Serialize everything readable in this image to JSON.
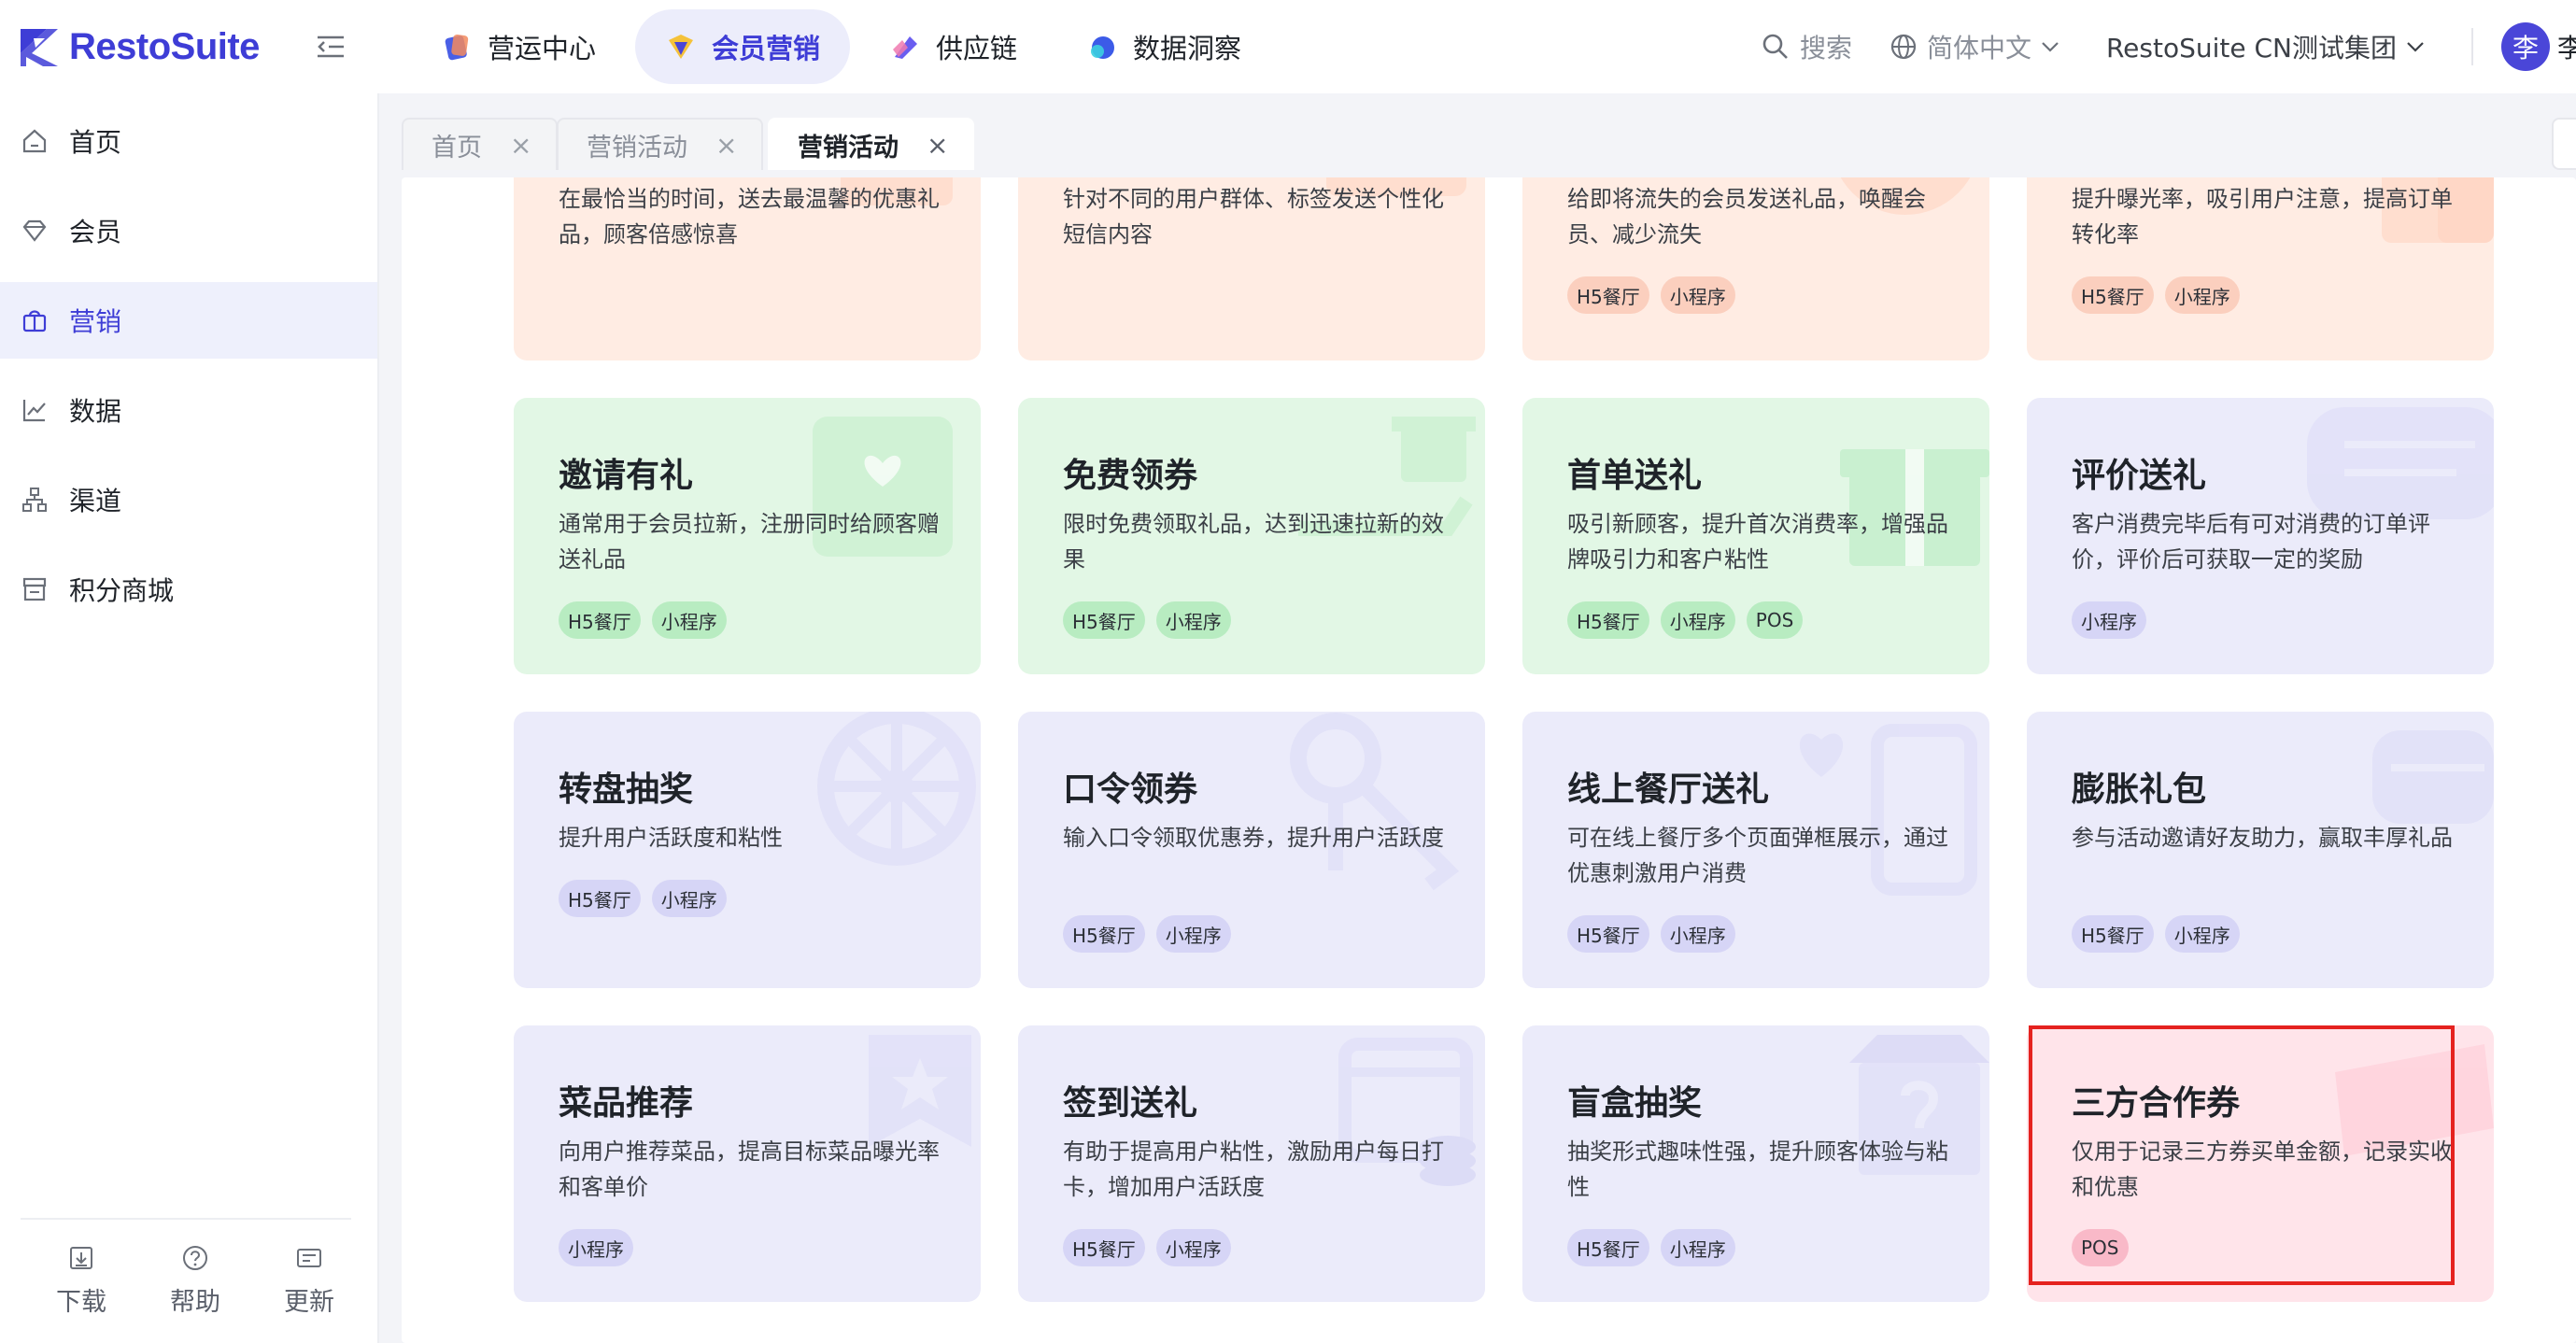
{
  "brand": {
    "name": "RestoSuite",
    "accent": "#3e3dd6"
  },
  "topnav": [
    {
      "label": "营运中心",
      "icon": "operations-icon",
      "active": false
    },
    {
      "label": "会员营销",
      "icon": "marketing-icon",
      "active": true
    },
    {
      "label": "供应链",
      "icon": "supply-chain-icon",
      "active": false
    },
    {
      "label": "数据洞察",
      "icon": "insights-icon",
      "active": false
    }
  ],
  "header": {
    "search_label": "搜索",
    "language": "简体中文",
    "org": "RestoSuite CN测试集团",
    "avatar_text": "李",
    "user_name": "李"
  },
  "sidebar": {
    "items": [
      {
        "label": "首页",
        "icon": "home-icon"
      },
      {
        "label": "会员",
        "icon": "diamond-icon"
      },
      {
        "label": "营销",
        "icon": "gift-bag-icon",
        "active": true
      },
      {
        "label": "数据",
        "icon": "chart-line-icon"
      },
      {
        "label": "渠道",
        "icon": "channel-icon"
      },
      {
        "label": "积分商城",
        "icon": "store-icon"
      }
    ],
    "footer": [
      {
        "label": "下载",
        "icon": "download-icon"
      },
      {
        "label": "帮助",
        "icon": "help-icon"
      },
      {
        "label": "更新",
        "icon": "update-icon"
      }
    ]
  },
  "tabs": [
    {
      "label": "首页",
      "active": false
    },
    {
      "label": "营销活动",
      "active": false
    },
    {
      "label": "营销活动",
      "active": true
    }
  ],
  "cards": [
    {
      "title": "",
      "desc": "在最恰当的时间，送去最温馨的优惠礼品，顾客倍感惊喜",
      "tags": [],
      "theme": "peach"
    },
    {
      "title": "",
      "desc": "针对不同的用户群体、标签发送个性化短信内容",
      "tags": [],
      "theme": "peach"
    },
    {
      "title": "",
      "desc": "给即将流失的会员发送礼品，唤醒会员、减少流失",
      "tags": [
        "H5餐厅",
        "小程序"
      ],
      "theme": "peach"
    },
    {
      "title": "",
      "desc": "提升曝光率，吸引用户注意，提高订单转化率",
      "tags": [
        "H5餐厅",
        "小程序"
      ],
      "theme": "peach"
    },
    {
      "title": "邀请有礼",
      "desc": "通常用于会员拉新，注册同时给顾客赠送礼品",
      "tags": [
        "H5餐厅",
        "小程序"
      ],
      "theme": "green"
    },
    {
      "title": "免费领券",
      "desc": "限时免费领取礼品，达到迅速拉新的效果",
      "tags": [
        "H5餐厅",
        "小程序"
      ],
      "theme": "green"
    },
    {
      "title": "首单送礼",
      "desc": "吸引新顾客，提升首次消费率，增强品牌吸引力和客户粘性",
      "tags": [
        "H5餐厅",
        "小程序",
        "POS"
      ],
      "theme": "green"
    },
    {
      "title": "评价送礼",
      "desc": "客户消费完毕后有可对消费的订单评价，评价后可获取一定的奖励",
      "tags": [
        "小程序"
      ],
      "theme": "lav"
    },
    {
      "title": "转盘抽奖",
      "desc": "提升用户活跃度和粘性",
      "tags": [
        "H5餐厅",
        "小程序"
      ],
      "theme": "lav"
    },
    {
      "title": "口令领券",
      "desc": "输入口令领取优惠券，提升用户活跃度",
      "tags": [
        "H5餐厅",
        "小程序"
      ],
      "theme": "lav"
    },
    {
      "title": "线上餐厅送礼",
      "desc": "可在线上餐厅多个页面弹框展示，通过优惠刺激用户消费",
      "tags": [
        "H5餐厅",
        "小程序"
      ],
      "theme": "lav"
    },
    {
      "title": "膨胀礼包",
      "desc": "参与活动邀请好友助力，赢取丰厚礼品",
      "tags": [
        "H5餐厅",
        "小程序"
      ],
      "theme": "lav"
    },
    {
      "title": "菜品推荐",
      "desc": "向用户推荐菜品，提高目标菜品曝光率和客单价",
      "tags": [
        "小程序"
      ],
      "theme": "lav"
    },
    {
      "title": "签到送礼",
      "desc": "有助于提高用户粘性，激励用户每日打卡，增加用户活跃度",
      "tags": [
        "H5餐厅",
        "小程序"
      ],
      "theme": "lav"
    },
    {
      "title": "盲盒抽奖",
      "desc": "抽奖形式趣味性强，提升顾客体验与粘性",
      "tags": [
        "H5餐厅",
        "小程序"
      ],
      "theme": "lav"
    },
    {
      "title": "三方合作券",
      "desc": "仅用于记录三方券买单金额，记录实收和优惠",
      "tags": [
        "POS"
      ],
      "theme": "pink"
    }
  ]
}
